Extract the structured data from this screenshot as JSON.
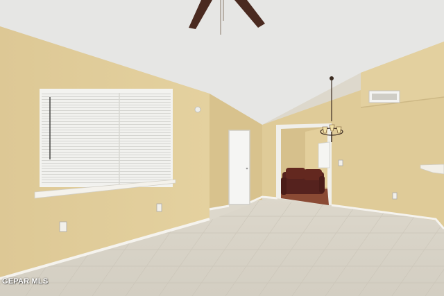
{
  "watermark": {
    "text": "GEPAR MLS"
  },
  "colors": {
    "ceiling": "#e8e8e6",
    "wall": "#ddc896",
    "wall_shadow": "#d2bc88",
    "trim": "#f4f2ec",
    "floor": "#d9d4c8",
    "sofa": "#5a2420",
    "fan_blade": "#4a2a20"
  },
  "fixtures": [
    "ceiling-fan",
    "chandelier",
    "window-blinds",
    "air-vent",
    "interior-door",
    "sofa"
  ]
}
